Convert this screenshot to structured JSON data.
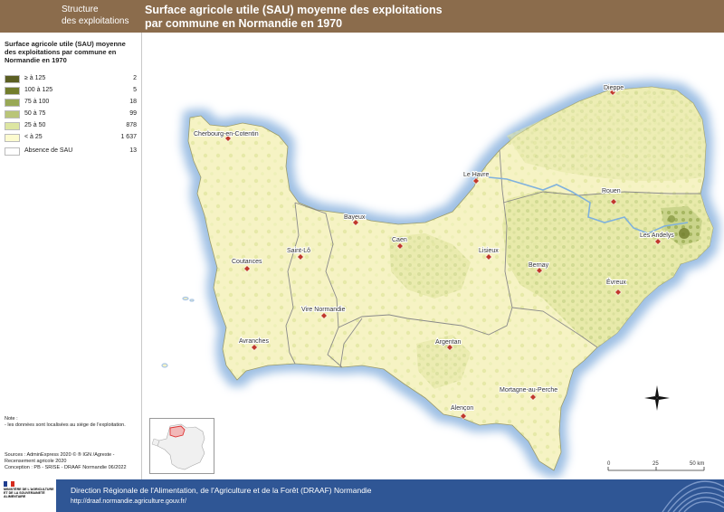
{
  "header": {
    "category": [
      "Structure",
      "des exploitations"
    ],
    "title_lines": [
      "Surface agricole utile (SAU) moyenne des exploitations",
      "par commune en Normandie en 1970"
    ]
  },
  "legend": {
    "title_lines": [
      "Surface agricole utile (SAU) moyenne",
      "des exploitations par commune en",
      "Normandie en 1970"
    ],
    "classes": [
      {
        "label": "≥ à 125",
        "count": "2",
        "color": "#5b5f23"
      },
      {
        "label": "100 à 125",
        "count": "5",
        "color": "#727d2c"
      },
      {
        "label": "75 à 100",
        "count": "18",
        "color": "#98a855"
      },
      {
        "label": "50 à 75",
        "count": "99",
        "color": "#b9c578"
      },
      {
        "label": "25 à 50",
        "count": "878",
        "color": "#dde6a2"
      },
      {
        "label": "< à 25",
        "count": "1 637",
        "color": "#fcfbcf"
      },
      {
        "label": "Absence de SAU",
        "count": "13",
        "color": "#ffffff"
      }
    ]
  },
  "note": {
    "heading": "Note :",
    "text": "- les données sont localisées au siège de l'exploitation."
  },
  "sources": [
    "Sources      : AdminExpress 2020 © ® IGN /Agreste -",
    "Recensement agricole 2020",
    "Conception : PB - SRISE - DRAAF Normandie 06/2022"
  ],
  "map": {
    "cities": [
      {
        "name": "Dieppe"
      },
      {
        "name": "Cherbourg-en-Cotentin"
      },
      {
        "name": "Le Havre"
      },
      {
        "name": "Rouen"
      },
      {
        "name": "Bayeux"
      },
      {
        "name": "Caen"
      },
      {
        "name": "Lisieux"
      },
      {
        "name": "Les Andelys"
      },
      {
        "name": "Saint-Lô"
      },
      {
        "name": "Coutances"
      },
      {
        "name": "Bernay"
      },
      {
        "name": "Évreux"
      },
      {
        "name": "Vire Normandie"
      },
      {
        "name": "Avranches"
      },
      {
        "name": "Argentan"
      },
      {
        "name": "Mortagne-au-Perche"
      },
      {
        "name": "Alençon"
      }
    ],
    "scale": {
      "labels": [
        "0",
        "25",
        "50 km"
      ]
    },
    "colors": {
      "sea": "#c8dcf0",
      "coast_glow": "#a9c6e6",
      "city_marker": "#c0392b",
      "region_fill": "#f6f3c4"
    }
  },
  "footer": {
    "org": "Direction Régionale de l'Alimentation, de l'Agriculture et de la Forêt (DRAAF) Normandie",
    "url": "http://draaf.normandie.agriculture.gouv.fr/",
    "ministry": "MINISTÈRE DE L'AGRICULTURE ET DE LA SOUVERAINETÉ ALIMENTAIRE",
    "colors": {
      "band": "#2f5695"
    }
  }
}
